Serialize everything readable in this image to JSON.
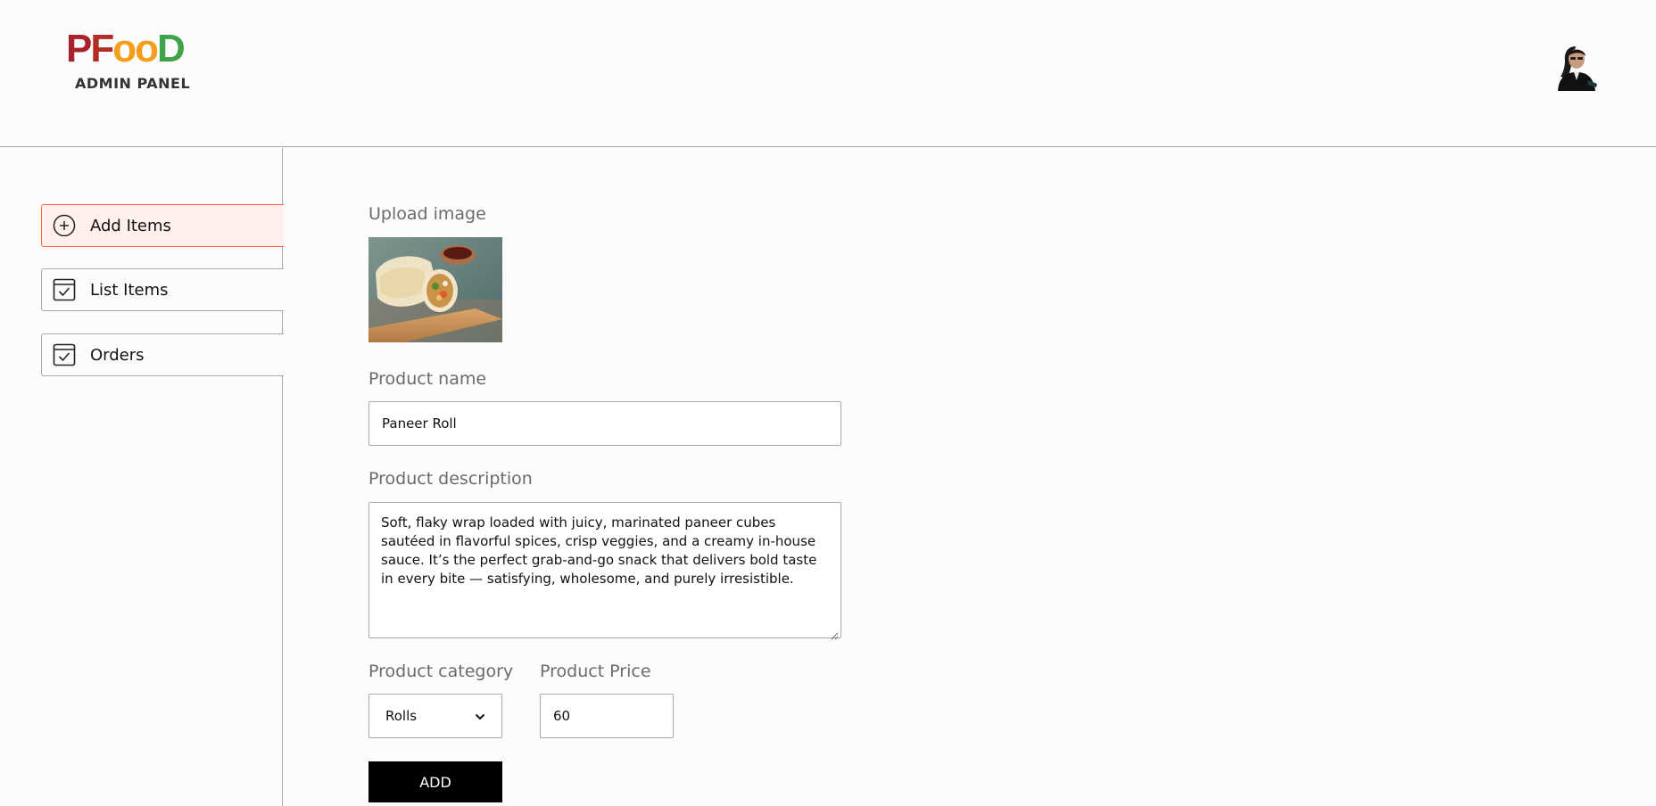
{
  "header": {
    "logo": {
      "word_p": "P",
      "word_f": "F",
      "word_oo": "oo",
      "word_d": "D",
      "subtitle": "ADMIN PANEL"
    },
    "profile_icon": "profile-avatar"
  },
  "sidebar": {
    "items": [
      {
        "label": "Add Items",
        "icon": "add-circle-icon",
        "active": true
      },
      {
        "label": "List Items",
        "icon": "checklist-icon",
        "active": false
      },
      {
        "label": "Orders",
        "icon": "checklist-icon",
        "active": false
      }
    ]
  },
  "form": {
    "upload_label": "Upload image",
    "product_name_label": "Product name",
    "product_name_value": "Paneer Roll",
    "description_label": "Product description",
    "description_value": "Soft, flaky wrap loaded with juicy, marinated paneer cubes sautéed in flavorful spices, crisp veggies, and a creamy in-house sauce. It’s the perfect grab-and-go snack that delivers bold taste in every bite — satisfying, wholesome, and purely irresistible.",
    "category_label": "Product category",
    "category_value": "Rolls",
    "price_label": "Product Price",
    "price_value": "60",
    "add_button": "ADD"
  },
  "colors": {
    "accent": "#ff6347",
    "active_bg": "#fff0ed",
    "border": "#a9a9a9",
    "button_bg": "#000000"
  }
}
